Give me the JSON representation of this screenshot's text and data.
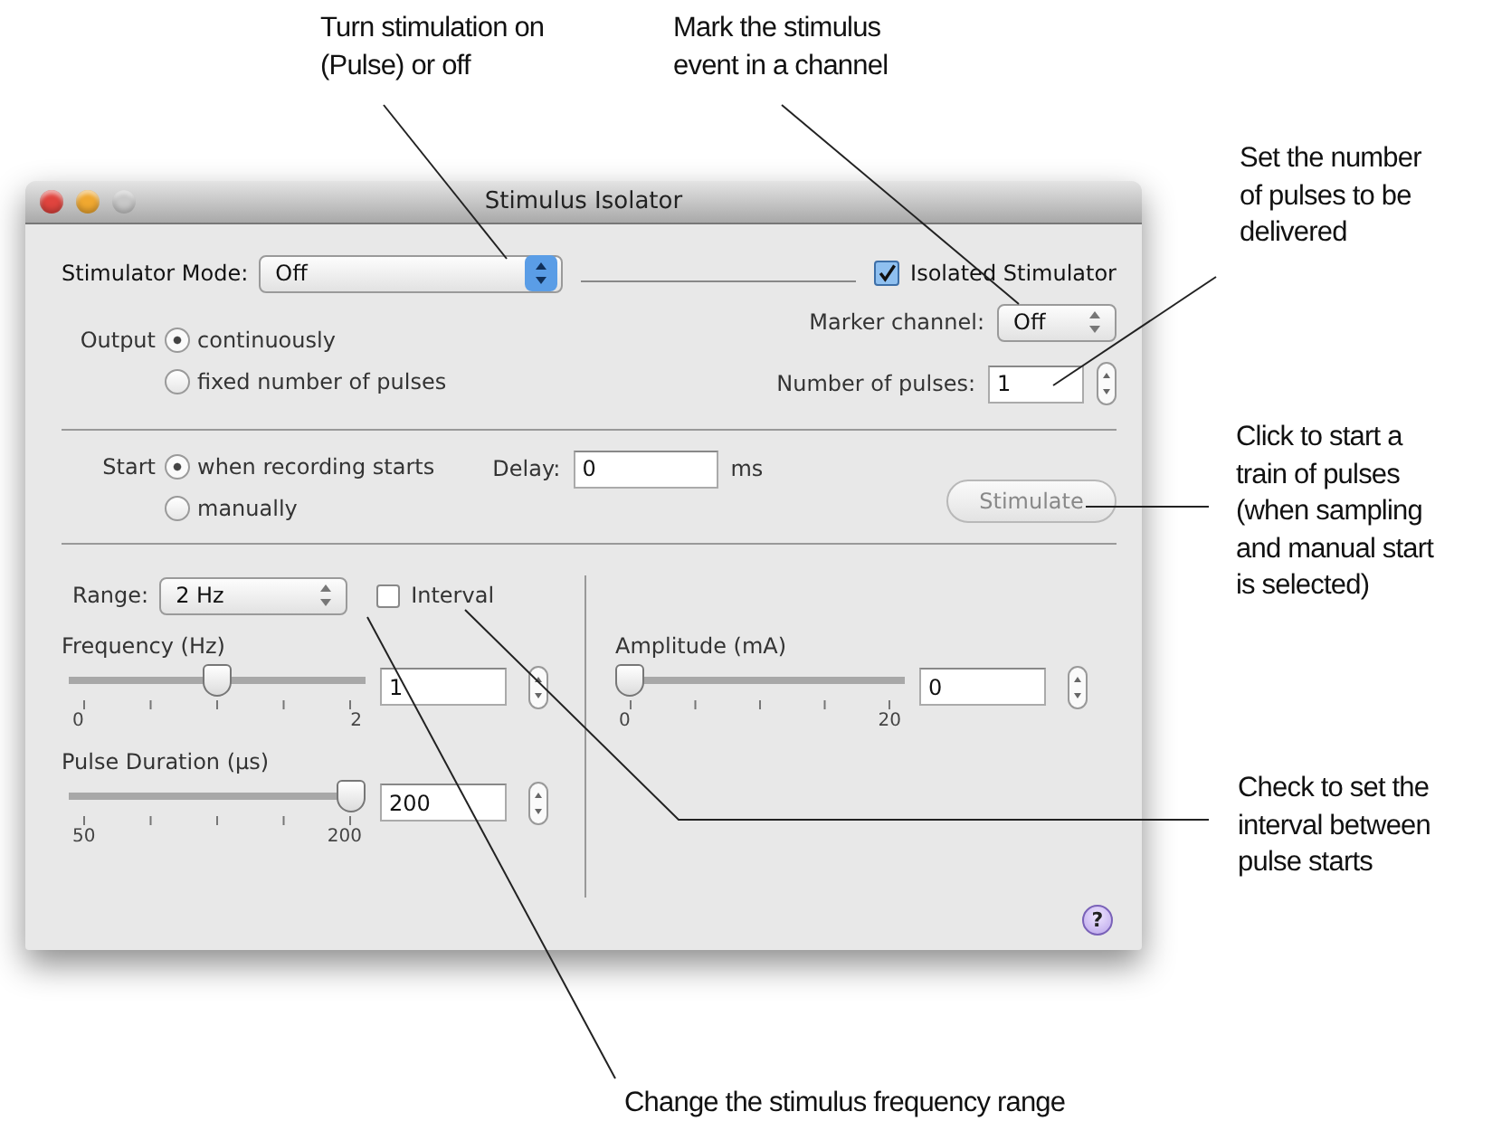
{
  "callouts": [
    {
      "text": "Turn stimulation on\n(Pulse) or off"
    },
    {
      "text": "Mark the stimulus\nevent in a channel"
    },
    {
      "text": "Set the number\nof pulses to be\ndelivered"
    },
    {
      "text": "Click to start a\ntrain of pulses\n(when sampling\nand manual start\nis selected)"
    },
    {
      "text": "Check to set the\ninterval between\npulse starts"
    },
    {
      "text": "Change the stimulus frequency range"
    }
  ],
  "window": {
    "title": "Stimulus Isolator",
    "buttons": [
      {
        "kind": "close",
        "disabled": false
      },
      {
        "kind": "minimize",
        "disabled": false
      },
      {
        "kind": "zoom",
        "disabled": true
      }
    ]
  },
  "stimulator_mode": {
    "label": "Stimulator Mode:",
    "value": "Off"
  },
  "isolated_stimulator": {
    "label": "Isolated Stimulator",
    "checked": true
  },
  "output": {
    "label": "Output",
    "options": [
      {
        "label": "continuously",
        "selected": true
      },
      {
        "label": "fixed number of pulses",
        "selected": false
      }
    ]
  },
  "marker_channel": {
    "label": "Marker channel:",
    "value": "Off"
  },
  "number_of_pulses": {
    "label": "Number of pulses:",
    "value": "1"
  },
  "start": {
    "label": "Start",
    "options": [
      {
        "label": "when recording starts",
        "selected": true
      },
      {
        "label": "manually",
        "selected": false
      }
    ]
  },
  "delay": {
    "label": "Delay:",
    "value": "0",
    "unit": "ms"
  },
  "stimulate_button": {
    "label": "Stimulate",
    "disabled": true
  },
  "range": {
    "label": "Range:",
    "value": "2 Hz"
  },
  "interval": {
    "label": "Interval",
    "checked": false
  },
  "sliders": [
    {
      "label": "Frequency (Hz)",
      "level": 0.5,
      "value": "1",
      "min_label": "0",
      "max_label": "2"
    },
    {
      "label": "Pulse Duration (µs)",
      "level": 1,
      "value": "200",
      "min_label": "50",
      "max_label": "200"
    },
    {
      "label": "Amplitude (mA)",
      "level": 0,
      "value": "0",
      "min_label": "0",
      "max_label": "20"
    }
  ],
  "help": {
    "glyph": "?"
  }
}
